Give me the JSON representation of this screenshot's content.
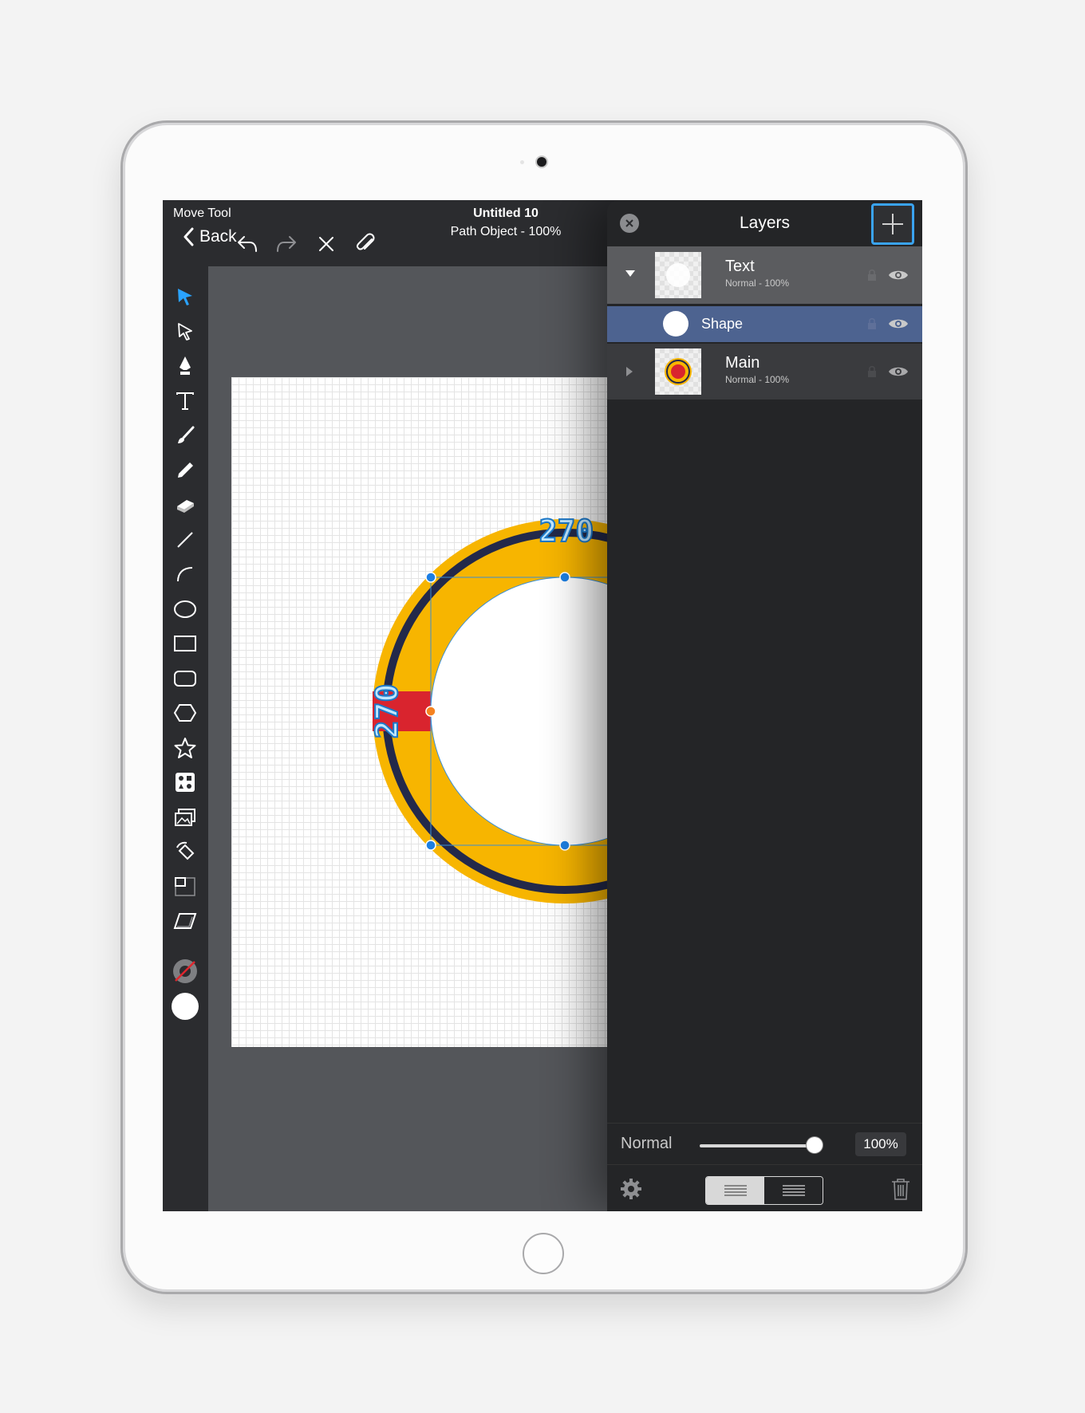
{
  "app": {
    "tool_name": "Move Tool",
    "back_label": "Back",
    "doc_title": "Untitled 10",
    "doc_subtitle": "Path Object - 100%"
  },
  "canvas": {
    "dimension_top": "270",
    "dimension_left": "270"
  },
  "layers_panel": {
    "title": "Layers",
    "layers": [
      {
        "name": "Text",
        "sub": "Normal - 100%",
        "expanded": true
      },
      {
        "name": "Shape",
        "sub": ""
      },
      {
        "name": "Main",
        "sub": "Normal - 100%",
        "expanded": false
      }
    ],
    "blend_mode": "Normal",
    "opacity": "100%",
    "opacity_value": 1.0
  },
  "colors": {
    "accent": "#3aa3f0",
    "ring_yellow": "#f7b500",
    "ring_navy": "#23294a",
    "ring_red": "#d9242e",
    "selected_row": "#4d6390"
  }
}
